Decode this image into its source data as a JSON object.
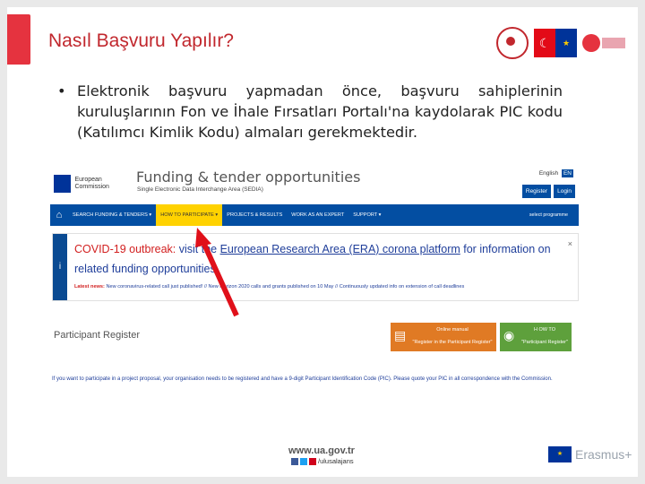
{
  "slide": {
    "title": "Nasıl Başvuru Yapılır?",
    "bullet": "Elektronik başvuru yapmadan önce, başvuru sahiplerinin kuruluşlarının Fon ve İhale Fırsatları Portalı'na kaydolarak PIC kodu (Katılımcı Kimlik Kodu) almaları gerekmektedir.",
    "bullet_marker": "•"
  },
  "portal": {
    "ec_logo_text": "European Commission",
    "title": "Funding & tender opportunities",
    "subtitle": "Single Electronic Data Interchange Area (SEDIA)",
    "language": "English",
    "lang_code": "EN",
    "register_label": "Register",
    "login_label": "Login",
    "nav": [
      {
        "label": "SEARCH FUNDING & TENDERS ▾"
      },
      {
        "label": "HOW TO PARTICIPATE ▾"
      },
      {
        "label": "PROJECTS & RESULTS"
      },
      {
        "label": "WORK AS AN EXPERT"
      },
      {
        "label": "SUPPORT ▾"
      }
    ],
    "select_programme": "select programme",
    "covid": {
      "headline_red": "COVID-19 outbreak:",
      "headline_mid": " visit the ",
      "headline_link": "European Research Area (ERA) corona platform",
      "headline_end": " for information on related funding opportunities",
      "latest_label": "Latest news:",
      "latest_text": "New coronavirus-related call just published! // New Horizon 2020 calls and grants published on 10 May // Continuously updated info on extension of call deadlines"
    },
    "participant_register": "Participant Register",
    "tile_manual": {
      "line1": "Online manual",
      "line2": "\"Register in the Participant Register\""
    },
    "tile_howto": {
      "line1": "H OW TO",
      "line2": "\"Participant Register\""
    },
    "info_text": "If you want to participate in a project proposal, your organisation needs to be registered and have a 9-digit Participant Identification Code (PIC). Please quote your PIC in all correspondence with the Commission."
  },
  "footer": {
    "url": "www.ua.gov.tr",
    "social": "/ulusalajans",
    "erasmus": "Erasmus+"
  },
  "colors": {
    "title_red": "#c1272d",
    "accent_red": "#e5333f",
    "portal_blue": "#034ea2",
    "nav_active": "#ffd200",
    "arrow_red": "#e0101a"
  }
}
